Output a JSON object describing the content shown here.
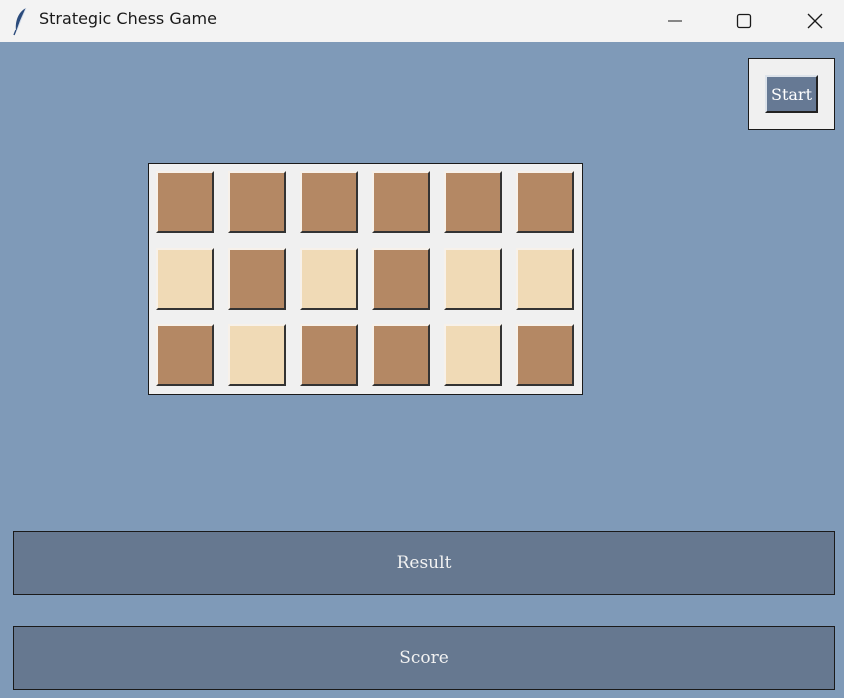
{
  "window": {
    "title": "Strategic Chess Game",
    "icon": "feather-icon",
    "controls": [
      "minimize-icon",
      "maximize-icon",
      "close-icon"
    ]
  },
  "colors": {
    "background": "#7f9ab8",
    "dark_square": "#b48864",
    "light_square": "#f0dab6",
    "bar": "#667890",
    "button": "#667994"
  },
  "start_button": {
    "label": "Start"
  },
  "board": {
    "rows": [
      [
        "dark",
        "dark",
        "dark",
        "dark",
        "dark",
        "dark"
      ],
      [
        "light",
        "dark",
        "light",
        "dark",
        "light",
        "light"
      ],
      [
        "dark",
        "light",
        "dark",
        "dark",
        "light",
        "dark"
      ]
    ]
  },
  "result": {
    "label": "Result"
  },
  "score": {
    "label": "Score"
  }
}
